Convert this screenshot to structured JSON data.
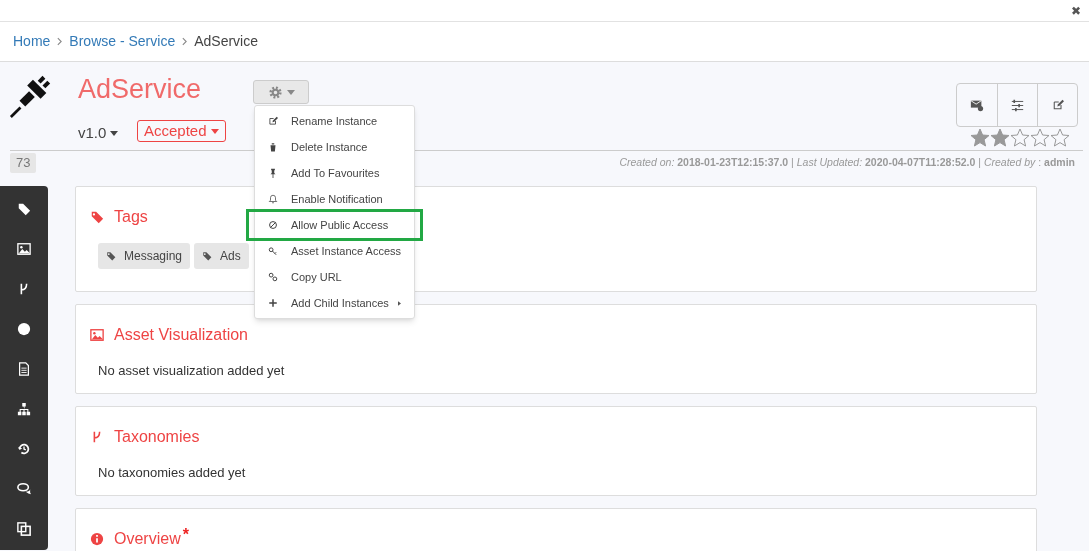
{
  "close_label": "✖",
  "breadcrumb": [
    {
      "label": "Home",
      "link": true
    },
    {
      "label": "Browse - Service",
      "link": true
    },
    {
      "label": "AdService",
      "link": false
    }
  ],
  "asset": {
    "title": "AdService",
    "version": "v1.0",
    "status": "Accepted",
    "count": "73",
    "stars": 2
  },
  "meta": "*Created on:* **2018-01-23T12:15:37.0** | *Last Updated:* **2020-04-07T11:28:52.0** | *Created by* : **admin**",
  "menu": {
    "expanded": true,
    "items": [
      {
        "label": "Rename Instance",
        "highlighted": false,
        "submenu": false
      },
      {
        "label": "Delete Instance",
        "highlighted": false,
        "submenu": false
      },
      {
        "label": "Add To Favourites",
        "highlighted": false,
        "submenu": false
      },
      {
        "label": "Enable Notification",
        "highlighted": false,
        "submenu": false
      },
      {
        "label": "Allow Public Access",
        "highlighted": true,
        "submenu": false
      },
      {
        "label": "Asset Instance Access",
        "highlighted": false,
        "submenu": false
      },
      {
        "label": "Copy URL",
        "highlighted": false,
        "submenu": false
      },
      {
        "label": "Add Child Instances",
        "highlighted": false,
        "submenu": true
      }
    ]
  },
  "sections": [
    {
      "title": "Tags",
      "tags": [
        "Messaging",
        "Ads"
      ]
    },
    {
      "title": "Asset Visualization",
      "text": "No asset visualization added yet"
    },
    {
      "title": "Taxonomies",
      "text": "No taxonomies added yet"
    },
    {
      "title": "Overview",
      "required_mark": "*"
    }
  ]
}
